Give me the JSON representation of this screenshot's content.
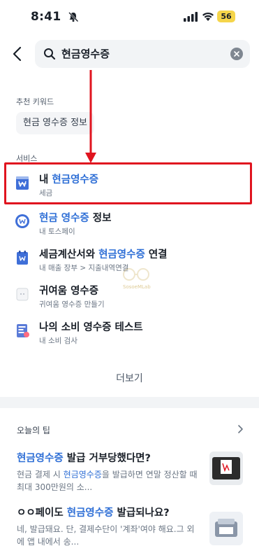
{
  "status_bar": {
    "time": "8:41",
    "battery": "56"
  },
  "search": {
    "query": "현금영수증"
  },
  "recommended": {
    "label": "추천 키워드",
    "chips": [
      "현금 영수증 정보"
    ]
  },
  "services": {
    "label": "서비스",
    "items": [
      {
        "title_pre": "내 ",
        "title_hl": "현금영수증",
        "title_post": "",
        "sub": "세금",
        "icon": "tax-receipt-icon"
      },
      {
        "title_pre": "",
        "title_hl": "현금 영수증",
        "title_post": " 정보",
        "sub": "내 토스페이",
        "icon": "won-coin-icon"
      },
      {
        "title_pre": "세금계산서와 ",
        "title_hl": "현금영수증",
        "title_post": " 연결",
        "sub": "내 매출 장부 > 지출내역연결",
        "icon": "document-won-icon"
      },
      {
        "title_pre": "귀여움 영수증",
        "title_hl": "",
        "title_post": "",
        "sub": "귀여움 영수증 만들기",
        "icon": "cute-receipt-icon"
      },
      {
        "title_pre": "나의 소비 영수증 테스트",
        "title_hl": "",
        "title_post": "",
        "sub": "내 소비 검사",
        "icon": "receipt-test-icon"
      }
    ],
    "more_label": "더보기"
  },
  "watermark": {
    "text": "SosoeMLab"
  },
  "tips": {
    "label": "오늘의 팁",
    "items": [
      {
        "title_hl": "현금영수증",
        "title_post": " 발급 거부당했다면?",
        "desc_pre": "현금 결제 시 ",
        "desc_hl": "현금영수증",
        "desc_post": "을 발급하면 연말 정산할 때 최대 300만원의 소..."
      },
      {
        "title_pre": "ㅇㅇ페이도 ",
        "title_hl": "현금영수증",
        "title_post": " 발급되나요?",
        "desc": "네, 발급돼요. 단, 결제수단이 '계좌'여야 해요.그 외에 앱 내에서 송..."
      }
    ]
  },
  "colors": {
    "highlight": "#2f6fd6",
    "annotation_red": "#e0141f"
  }
}
